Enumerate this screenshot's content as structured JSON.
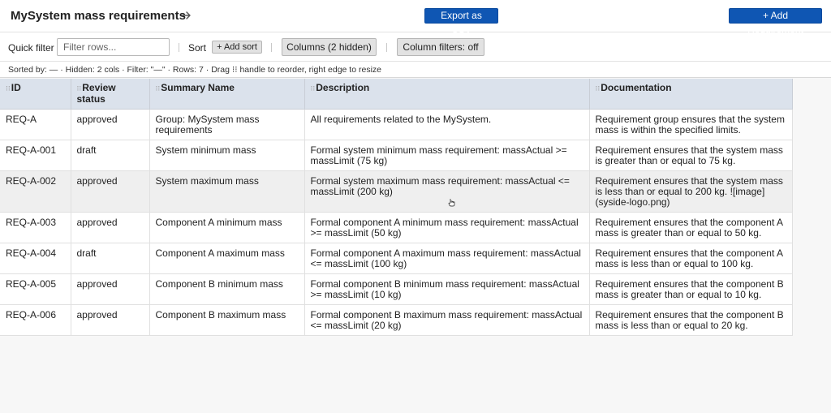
{
  "header": {
    "title": "MySystem mass requirements",
    "export_label": "Export as CSV",
    "add_requirement_label": "+ Add Requirement"
  },
  "toolbar": {
    "quick_filter_label": "Quick filter",
    "filter_placeholder": "Filter rows...",
    "filter_value": "",
    "sort_label": "Sort",
    "add_sort_label": "+ Add sort",
    "columns_label": "Columns (2 hidden)",
    "column_filters_label": "Column filters: off"
  },
  "status": {
    "text": "Sorted by: — · Hidden: 2 cols · Filter: \"—\" · Rows: 7 · Drag ⁝⁝ handle to reorder, right edge to resize"
  },
  "table": {
    "columns": [
      {
        "grip": "⁝⁝",
        "label": "ID"
      },
      {
        "grip": "⁝⁝",
        "label": "Review status"
      },
      {
        "grip": "⁝⁝",
        "label": "Summary Name"
      },
      {
        "grip": "⁝⁝",
        "label": "Description"
      },
      {
        "grip": "⁝⁝",
        "label": "Documentation"
      }
    ],
    "rows": [
      {
        "id": "REQ-A",
        "status": "approved",
        "name": "Group: MySystem mass requirements",
        "description": "All requirements related to the MySystem.",
        "documentation": "Requirement group ensures that the system mass is within the specified limits."
      },
      {
        "id": "REQ-A-001",
        "status": "draft",
        "name": "System minimum mass",
        "description": "Formal system minimum mass requirement: massActual >= massLimit (75 kg)",
        "documentation": "Requirement ensures that the system mass is greater than or equal to 75 kg."
      },
      {
        "id": "REQ-A-002",
        "status": "approved",
        "name": "System maximum mass",
        "description": "Formal system maximum mass requirement: massActual <= massLimit (200 kg)",
        "documentation": "Requirement ensures that the system mass is less than or equal to 200 kg. ![image](syside-logo.png)"
      },
      {
        "id": "REQ-A-003",
        "status": "approved",
        "name": "Component A minimum mass",
        "description": "Formal component A minimum mass requirement: massActual >= massLimit (50 kg)",
        "documentation": "Requirement ensures that the component A mass is greater than or equal to 50 kg."
      },
      {
        "id": "REQ-A-004",
        "status": "draft",
        "name": "Component A maximum mass",
        "description": "Formal component A maximum mass requirement: massActual <= massLimit (100 kg)",
        "documentation": "Requirement ensures that the component A mass is less than or equal to 100 kg."
      },
      {
        "id": "REQ-A-005",
        "status": "approved",
        "name": "Component B minimum mass",
        "description": "Formal component B minimum mass requirement: massActual >= massLimit (10 kg)",
        "documentation": "Requirement ensures that the component B mass is greater than or equal to 10 kg."
      },
      {
        "id": "REQ-A-006",
        "status": "approved",
        "name": "Component B maximum mass",
        "description": "Formal component B maximum mass requirement: massActual <= massLimit (20 kg)",
        "documentation": "Requirement ensures that the component B mass is less than or equal to 20 kg."
      }
    ]
  },
  "icons": {
    "title_arrow": "arrow-right-icon",
    "cursor": "hand-pointer-icon"
  },
  "colors": {
    "primary_button": "#0f56b3",
    "header_row": "#dbe2ec",
    "highlight_row": "#efefef"
  }
}
